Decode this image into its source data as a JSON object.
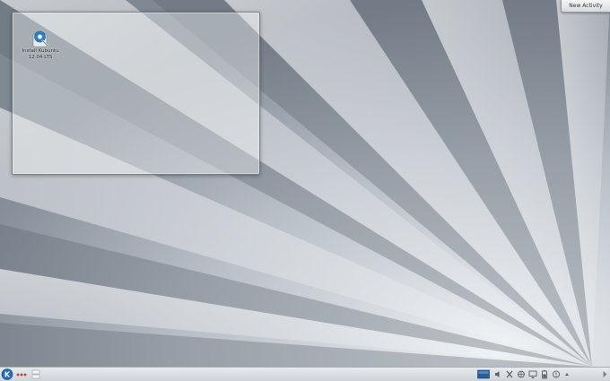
{
  "colors": {
    "wallpaper_base": "#9aa3ad",
    "ray_light": "#d6dce2",
    "taskbar_bg": "#dcdfe2",
    "kmenu_blue": "#1e6fb8"
  },
  "activity_button": {
    "label": "New Activity"
  },
  "desktop": {
    "icons": [
      {
        "icon": "installer-icon",
        "label_line1": "Install Kubuntu",
        "label_line2": "12.04 LTS"
      }
    ]
  },
  "taskbar": {
    "kmenu_icon": "kde-logo-icon",
    "activity_icon": "activity-dots-icon",
    "pager_icon": "pager-icon",
    "tray_icons": [
      "speaker-icon",
      "clipboard-icon",
      "network-icon",
      "monitor-icon",
      "battery-icon",
      "notification-icon",
      "expand-icon"
    ],
    "clock": {
      "time": "",
      "date": ""
    }
  }
}
